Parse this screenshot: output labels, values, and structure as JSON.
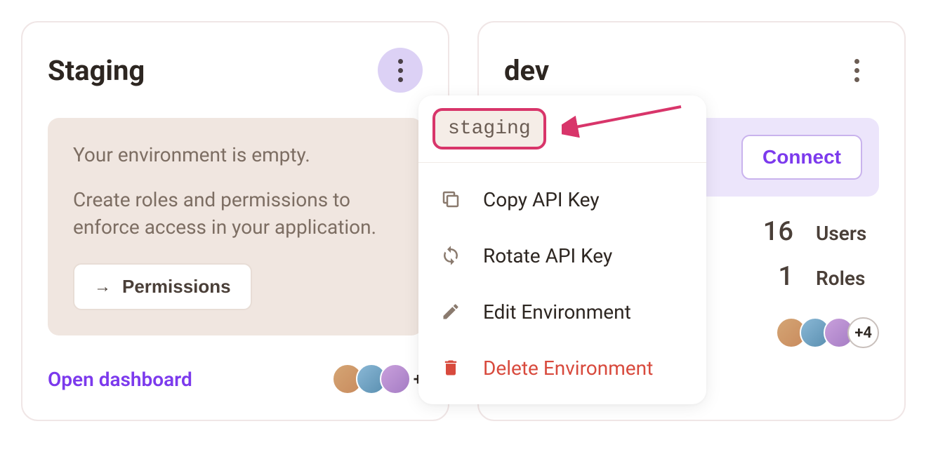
{
  "staging_card": {
    "title": "Staging",
    "empty_title": "Your environment is empty.",
    "empty_desc": "Create roles and permissions to enforce access in your application.",
    "permissions_label": "Permissions",
    "open_dashboard": "Open dashboard",
    "avatar_overflow": "+"
  },
  "dev_card": {
    "title": "dev",
    "connect_label": "Connect",
    "stats": {
      "users_value": "16",
      "users_label": "Users",
      "roles_value": "1",
      "roles_label": "Roles"
    },
    "avatar_overflow": "+4"
  },
  "dropdown": {
    "env_tag": "staging",
    "items": {
      "copy_api_key": "Copy API Key",
      "rotate_api_key": "Rotate API Key",
      "edit_environment": "Edit Environment",
      "delete_environment": "Delete Environment"
    }
  },
  "colors": {
    "accent_purple": "#7c3aed",
    "danger_red": "#d84a3d",
    "annotation_pink": "#d8356a"
  }
}
